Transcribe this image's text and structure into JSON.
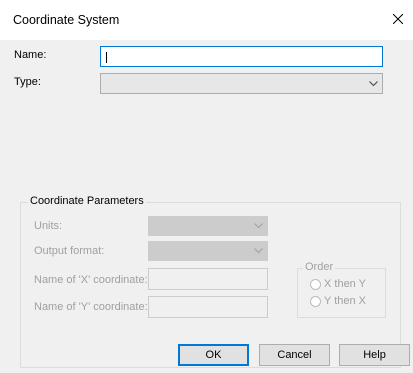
{
  "dialog": {
    "title": "Coordinate System",
    "close_icon": "close-icon"
  },
  "form": {
    "name_label": "Name:",
    "name_value": "",
    "type_label": "Type:",
    "type_value": ""
  },
  "params": {
    "group_title": "Coordinate Parameters",
    "units_label": "Units:",
    "output_format_label": "Output format:",
    "x_coord_label": "Name of 'X' coordinate:",
    "y_coord_label": "Name of 'Y' coordinate:",
    "order": {
      "title": "Order",
      "x_then_y": "X then Y",
      "y_then_x": "Y then X"
    }
  },
  "buttons": {
    "ok": "OK",
    "cancel": "Cancel",
    "help": "Help"
  },
  "colors": {
    "accent": "#0078d7",
    "disabled_text": "#a0a0a0"
  }
}
